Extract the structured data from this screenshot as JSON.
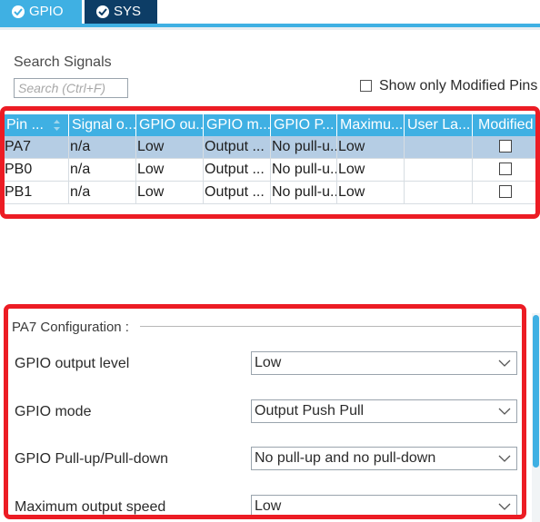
{
  "tabs": [
    {
      "label": "GPIO",
      "icon": "check-circle-icon"
    },
    {
      "label": "SYS",
      "icon": "check-circle-icon"
    }
  ],
  "search": {
    "label": "Search Signals",
    "placeholder": "Search (Ctrl+F)",
    "value": ""
  },
  "show_modified": {
    "label": "Show only Modified Pins",
    "checked": false
  },
  "table": {
    "columns": [
      "Pin ...",
      "Signal o...",
      "GPIO ou...",
      "GPIO m...",
      "GPIO P...",
      "Maximu...",
      "User La...",
      "Modified"
    ],
    "rows": [
      {
        "pin": "PA7",
        "signal": "n/a",
        "gpio_output": "Low",
        "gpio_mode": "Output ...",
        "gpio_pull": "No pull-u...",
        "max_speed": "Low",
        "user_label": "",
        "modified": false,
        "selected": true
      },
      {
        "pin": "PB0",
        "signal": "n/a",
        "gpio_output": "Low",
        "gpio_mode": "Output ...",
        "gpio_pull": "No pull-u...",
        "max_speed": "Low",
        "user_label": "",
        "modified": false,
        "selected": false
      },
      {
        "pin": "PB1",
        "signal": "n/a",
        "gpio_output": "Low",
        "gpio_mode": "Output ...",
        "gpio_pull": "No pull-u...",
        "max_speed": "Low",
        "user_label": "",
        "modified": false,
        "selected": false
      }
    ]
  },
  "config": {
    "title": "PA7 Configuration :",
    "fields": [
      {
        "label": "GPIO output level",
        "value": "Low"
      },
      {
        "label": "GPIO mode",
        "value": "Output Push Pull"
      },
      {
        "label": "GPIO Pull-up/Pull-down",
        "value": "No pull-up and no pull-down"
      },
      {
        "label": "Maximum output speed",
        "value": "Low"
      }
    ]
  },
  "colors": {
    "accent": "#3fb0e3",
    "sys_tab": "#0d3d66",
    "selected_row": "#b5cde4",
    "highlight": "#ec1c24"
  }
}
